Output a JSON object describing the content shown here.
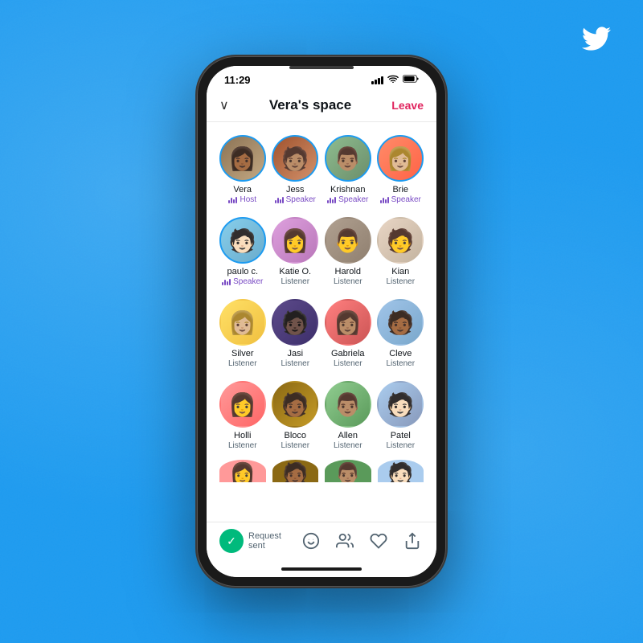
{
  "background": {
    "color": "#1d9bf0"
  },
  "statusBar": {
    "time": "11:29"
  },
  "header": {
    "title": "Vera's space",
    "leaveLabel": "Leave",
    "chevron": "∨"
  },
  "participants": [
    {
      "id": 1,
      "name": "Vera",
      "role": "Host",
      "roleType": "host",
      "avatarClass": "av-vera",
      "emoji": "👩🏾"
    },
    {
      "id": 2,
      "name": "Jess",
      "role": "Speaker",
      "roleType": "speaker",
      "avatarClass": "av-jess",
      "emoji": "🧑🏽"
    },
    {
      "id": 3,
      "name": "Krishnan",
      "role": "Speaker",
      "roleType": "speaker",
      "avatarClass": "av-krishnan",
      "emoji": "👨🏽"
    },
    {
      "id": 4,
      "name": "Brie",
      "role": "Speaker",
      "roleType": "speaker",
      "avatarClass": "av-brie",
      "emoji": "👩🏼"
    },
    {
      "id": 5,
      "name": "paulo c.",
      "role": "Speaker",
      "roleType": "speaker",
      "avatarClass": "av-paulo",
      "emoji": "🧑🏻"
    },
    {
      "id": 6,
      "name": "Katie O.",
      "role": "Listener",
      "roleType": "listener",
      "avatarClass": "av-katie",
      "emoji": "👩"
    },
    {
      "id": 7,
      "name": "Harold",
      "role": "Listener",
      "roleType": "listener",
      "avatarClass": "av-harold",
      "emoji": "👨"
    },
    {
      "id": 8,
      "name": "Kian",
      "role": "Listener",
      "roleType": "listener",
      "avatarClass": "av-kian",
      "emoji": "🧑"
    },
    {
      "id": 9,
      "name": "Silver",
      "role": "Listener",
      "roleType": "listener",
      "avatarClass": "av-silver",
      "emoji": "👩🏼"
    },
    {
      "id": 10,
      "name": "Jasi",
      "role": "Listener",
      "roleType": "listener",
      "avatarClass": "av-jasi",
      "emoji": "🧑🏿"
    },
    {
      "id": 11,
      "name": "Gabriela",
      "role": "Listener",
      "roleType": "listener",
      "avatarClass": "av-gabriela",
      "emoji": "👩🏽"
    },
    {
      "id": 12,
      "name": "Cleve",
      "role": "Listener",
      "roleType": "listener",
      "avatarClass": "av-cleve",
      "emoji": "🧑🏾"
    },
    {
      "id": 13,
      "name": "Holli",
      "role": "Listener",
      "roleType": "listener",
      "avatarClass": "av-holli",
      "emoji": "👩"
    },
    {
      "id": 14,
      "name": "Bloco",
      "role": "Listener",
      "roleType": "listener",
      "avatarClass": "av-bloco",
      "emoji": "🧑🏾"
    },
    {
      "id": 15,
      "name": "Allen",
      "role": "Listener",
      "roleType": "listener",
      "avatarClass": "av-allen",
      "emoji": "👨🏽"
    },
    {
      "id": 16,
      "name": "Patel",
      "role": "Listener",
      "roleType": "listener",
      "avatarClass": "av-patel",
      "emoji": "🧑🏻"
    }
  ],
  "bottomBar": {
    "requestSentLabel": "Request sent",
    "checkIcon": "✓"
  }
}
